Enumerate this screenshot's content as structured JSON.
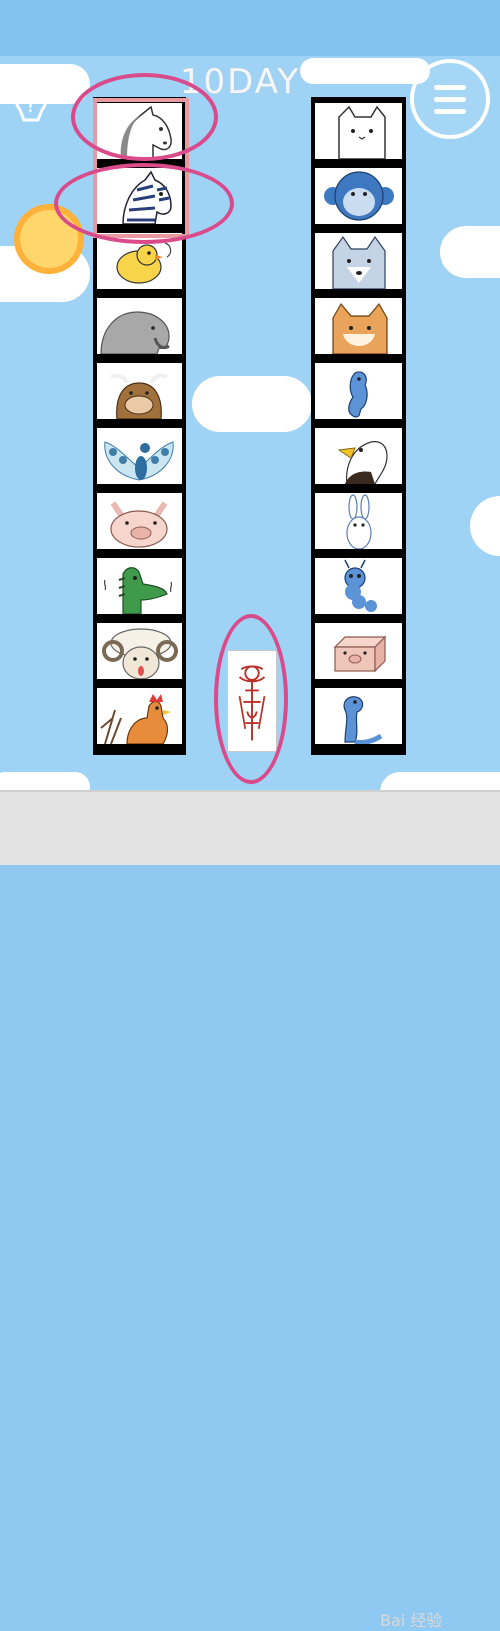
{
  "header": {
    "day_label": "10DAY"
  },
  "buttons": {
    "hint_icon": "lightbulb-question-icon",
    "menu_icon": "hamburger-menu-icon"
  },
  "columns": {
    "left": [
      "horse",
      "zebra",
      "chick",
      "elephant",
      "ox",
      "peacock",
      "pig",
      "crocodile",
      "sheep",
      "rooster"
    ],
    "right": [
      "cat",
      "monkey",
      "wolf",
      "shiba-dog",
      "seahorse",
      "eagle",
      "rabbit",
      "caterpillar",
      "pig-box",
      "snake"
    ]
  },
  "selected_cells": [
    "horse",
    "zebra"
  ],
  "extra_card": "talisman",
  "watermark": {
    "text": "Bai 经验"
  },
  "colors": {
    "sky": "#9fd3f5",
    "highlight_ring": "#d94b8a",
    "selection_box": "#e89aa0"
  }
}
